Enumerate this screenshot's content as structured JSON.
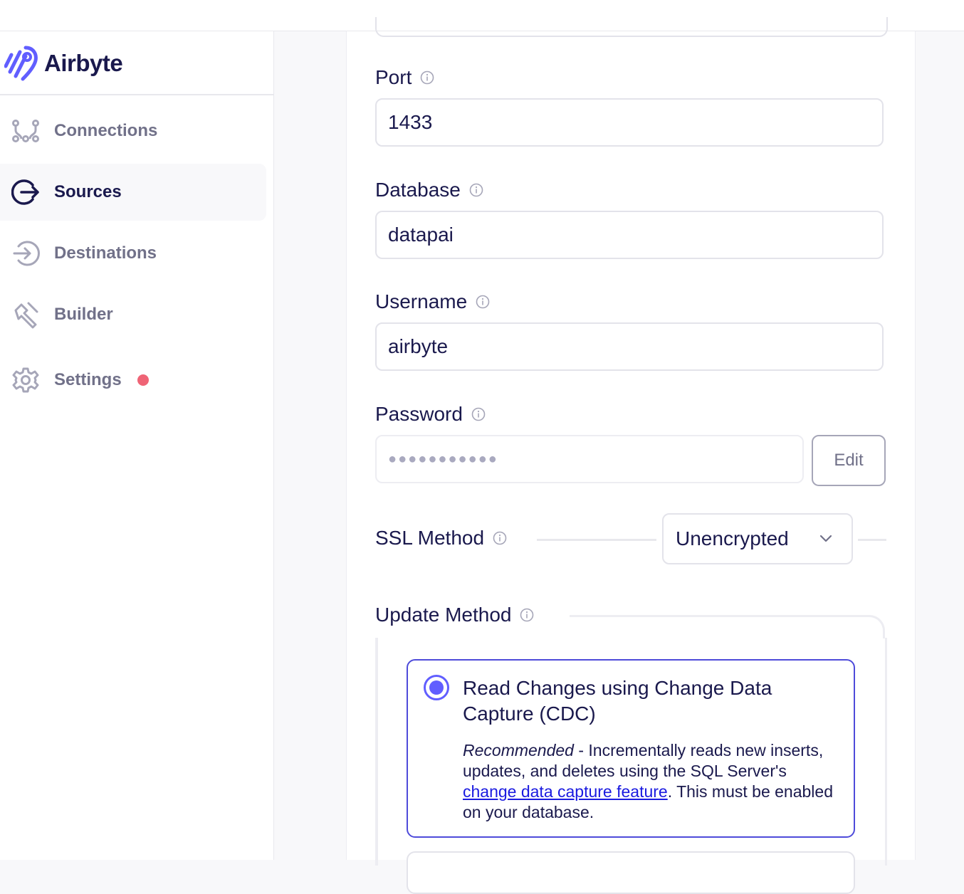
{
  "app": {
    "name": "Airbyte"
  },
  "sidebar": {
    "items": [
      {
        "label": "Connections",
        "icon": "connections-icon",
        "active": false
      },
      {
        "label": "Sources",
        "icon": "sources-icon",
        "active": true
      },
      {
        "label": "Destinations",
        "icon": "destinations-icon",
        "active": false
      },
      {
        "label": "Builder",
        "icon": "builder-icon",
        "active": false
      },
      {
        "label": "Settings",
        "icon": "gear-icon",
        "active": false,
        "notification": true
      }
    ]
  },
  "form": {
    "port": {
      "label": "Port",
      "value": "1433"
    },
    "database": {
      "label": "Database",
      "value": "datapai"
    },
    "username": {
      "label": "Username",
      "value": "airbyte"
    },
    "password": {
      "label": "Password",
      "masked_value": "●●●●●●●●●●●",
      "edit_label": "Edit"
    },
    "ssl_method": {
      "label": "SSL Method",
      "selected": "Unencrypted"
    },
    "update_method": {
      "label": "Update Method",
      "options": [
        {
          "title": "Read Changes using Change Data Capture (CDC)",
          "selected": true,
          "desc_em": "Recommended",
          "desc_part1": " - Incrementally reads new inserts, updates, and deletes using the SQL Server's ",
          "desc_link": "change data capture feature",
          "desc_part2": ". This must be enabled on your database."
        }
      ]
    }
  },
  "colors": {
    "accent": "#615eff",
    "text": "#1a194d",
    "muted": "#717189",
    "notification": "#ef6476"
  }
}
